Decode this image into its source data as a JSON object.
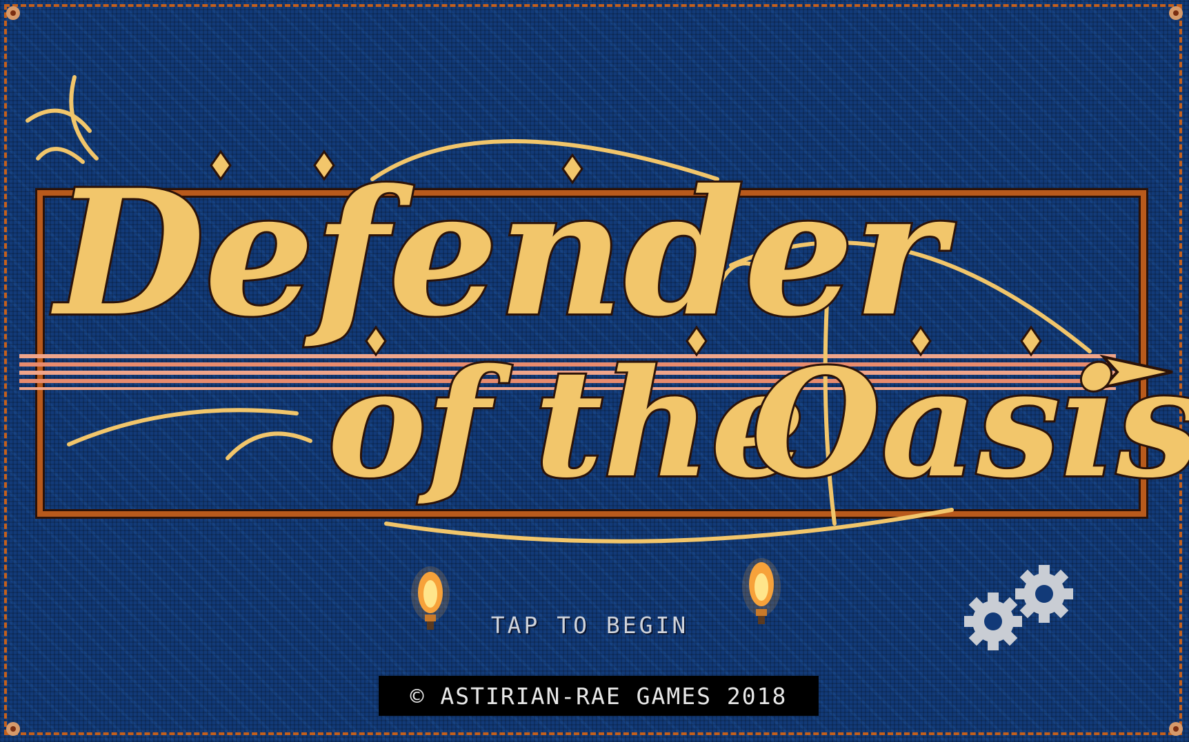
{
  "title": {
    "line1": "Defender",
    "line2_of": "of",
    "line2_the": "the",
    "line2_oasis": "Oasis"
  },
  "prompt": {
    "tap_label": "TAP TO BEGIN"
  },
  "footer": {
    "copyright": "© ASTIRIAN-RAE GAMES 2018"
  },
  "icons": {
    "settings": "gears-icon",
    "torch": "torch-icon"
  },
  "colors": {
    "background": "#123a78",
    "gold": "#f2c66b",
    "border": "#c4601c",
    "text": "#cfd3da"
  }
}
